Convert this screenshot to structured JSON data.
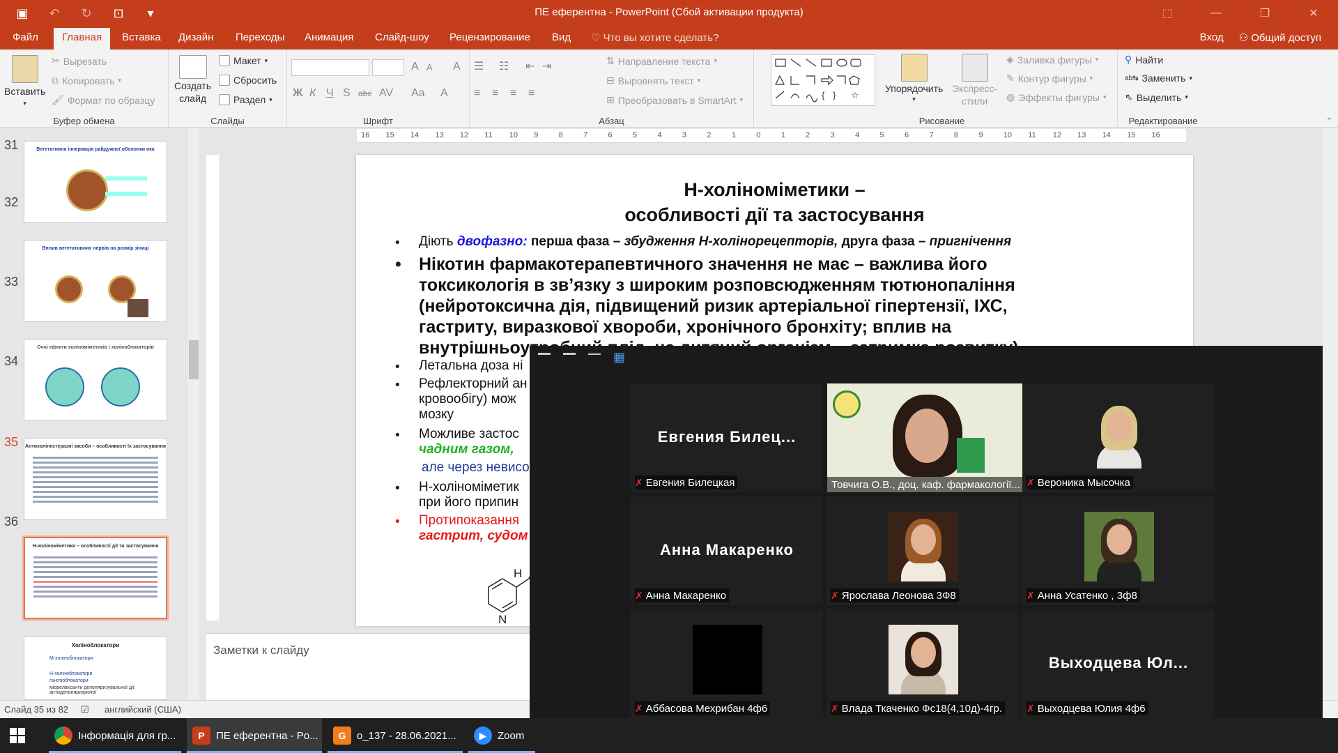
{
  "window": {
    "title": "ПЕ еферентна - PowerPoint (Сбой активации продукта)",
    "controls": [
      "⬚",
      "—",
      "❐",
      "✕"
    ]
  },
  "tabs": [
    "Файл",
    "Главная",
    "Вставка",
    "Дизайн",
    "Переходы",
    "Анимация",
    "Слайд-шоу",
    "Рецензирование",
    "Вид"
  ],
  "tellme": "Что вы хотите сделать?",
  "tabs_right": {
    "login": "Вход",
    "share": "Общий доступ"
  },
  "ribbon": {
    "clipboard": {
      "paste": "Вставить",
      "cut": "Вырезать",
      "copy": "Копировать",
      "format": "Формат по образцу",
      "label": "Буфер обмена"
    },
    "slides": {
      "new": "Создать",
      "new2": "слайд",
      "layout": "Макет",
      "reset": "Сбросить",
      "section": "Раздел",
      "label": "Слайды"
    },
    "font": {
      "label": "Шрифт"
    },
    "paragraph": {
      "dir": "Направление текста",
      "align": "Выровнять текст",
      "smartart": "Преобразовать в SmartArt",
      "label": "Абзац"
    },
    "drawing": {
      "arrange": "Упорядочить",
      "styles1": "Экспресс-",
      "styles2": "стили",
      "fill": "Заливка фигуры",
      "outline": "Контур фигуры",
      "effects": "Эффекты фигуры",
      "label": "Рисование"
    },
    "editing": {
      "find": "Найти",
      "replace": "Заменить",
      "select": "Выделить",
      "label": "Редактирование"
    }
  },
  "ruler": [
    "16",
    "15",
    "14",
    "13",
    "12",
    "11",
    "10",
    "9",
    "8",
    "7",
    "6",
    "5",
    "4",
    "3",
    "2",
    "1",
    "0",
    "1",
    "2",
    "3",
    "4",
    "5",
    "6",
    "7",
    "8",
    "9",
    "10",
    "11",
    "12",
    "13",
    "14",
    "15",
    "16"
  ],
  "thumbnails": [
    {
      "num": "31",
      "title": "Вегетативна іннервація райдужної оболонки ока"
    },
    {
      "num": "32",
      "title": "Вплив вегетативних нервів на розмір зіниці"
    },
    {
      "num": "33",
      "title": "Очні ефекти холіноміметиків і холіноблокаторів"
    },
    {
      "num": "34",
      "title": "Антихолінестеразні засоби – особливості їх застосування"
    },
    {
      "num": "35",
      "title": "Н-холіноміметики – особливості дії та застосування"
    },
    {
      "num": "36",
      "title": "Холіноблокатори",
      "lines": [
        "М-холіноблокатори",
        "Н-холіноблокатори",
        "гангліоблокатори",
        "міорелаксанти деполяризувальної дії, антидеполяризуючої"
      ]
    }
  ],
  "slide": {
    "title1": "Н-холіноміметики –",
    "title2": "особливості дії та застосування",
    "b1": {
      "a": "Діють ",
      "b": "двофазно:",
      "c": " перша фаза – ",
      "d": "збудження Н-холінорецепторів,",
      "e": " друга фаза – ",
      "f": "пригнічення"
    },
    "b2": [
      "Нікотин фармакотерапевтичного значення не має – важлива його",
      "токсикологія в зв’язку з широким розповсюдженням тютюнопаління",
      "(нейротоксична дія, підвищений ризик артеріальної гіпертензії, ІХС,",
      "гастриту, виразкової хвороби, хронічного бронхіту; вплив  на",
      "внутрішньоутробний плід, на дитячий організм – затримка розвитку)"
    ],
    "b3": "Летальна доза ні",
    "b4": [
      "Рефлекторний ан",
      "кровообігу) мож",
      "мозку"
    ],
    "b5": [
      "Можливе застос",
      "чадним газом,",
      "але через невисо"
    ],
    "b6": [
      "Н-холіноміметик",
      "при його припин"
    ],
    "b7": [
      "Протипоказання",
      "гастрит, судом"
    ],
    "mol_h": "H",
    "mol_n": "N"
  },
  "notes": "Заметки к слайду",
  "status": {
    "slide": "Слайд 35 из 82",
    "lang": "английский (США)"
  },
  "zoom": {
    "participants": [
      {
        "name": "Евгения  Билец...",
        "label": "Евгения Билецкая",
        "type": "name"
      },
      {
        "name": "",
        "label": "Товчига О.В., доц. каф. фармакології...",
        "type": "speaker"
      },
      {
        "name": "",
        "label": "Вероника Мысочка",
        "type": "photo"
      },
      {
        "name": "Анна Макаренко",
        "label": "Анна Макаренко",
        "type": "name"
      },
      {
        "name": "",
        "label": "Ярослава Леонова 3Ф8",
        "type": "photo"
      },
      {
        "name": "",
        "label": "Анна Усатенко , 3ф8",
        "type": "photo"
      },
      {
        "name": "",
        "label": "Аббасова Мехрибан 4ф6",
        "type": "black"
      },
      {
        "name": "",
        "label": "Влада Ткаченко Фс18(4,10д)-4гр.",
        "type": "photo"
      },
      {
        "name": "Выходцева  Юл...",
        "label": "Выходцева Юлия 4ф6",
        "type": "name"
      }
    ]
  },
  "taskbar": [
    {
      "label": "Інформація для гр...",
      "icon": "chrome-icon"
    },
    {
      "label": "ПЕ еферентна - Po...",
      "icon": "powerpoint-icon"
    },
    {
      "label": "o_137 - 28.06.2021...",
      "icon": "file-icon"
    },
    {
      "label": "Zoom",
      "icon": "zoom-icon"
    }
  ],
  "colors": {
    "accent": "#c43e1c",
    "active_thumb": "#e07a56",
    "zoom_bg": "#1a1a1a",
    "muted_mic": "#e8303a"
  }
}
